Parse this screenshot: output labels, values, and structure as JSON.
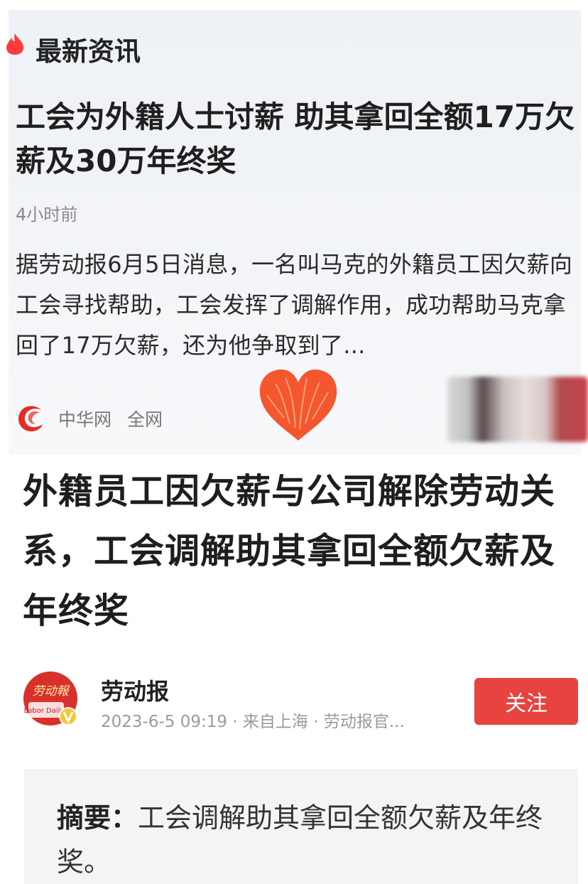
{
  "news_card": {
    "section_title": "最新资讯",
    "headline": "工会为外籍人士讨薪 助其拿回全额17万欠薪及30万年终奖",
    "time_ago": "4小时前",
    "summary": "据劳动报6月5日消息，一名叫马克的外籍员工因欠薪向工会寻找帮助，工会发挥了调解作用，成功帮助马克拿回了17万欠薪，还为他争取到了...",
    "source_name": "中华网",
    "source_scope": "全网"
  },
  "article": {
    "title": "外籍员工因欠薪与公司解除劳动关系，工会调解助其拿回全额欠薪及年终奖",
    "author": "劳动报",
    "meta": "2023-6-5 09:19 · 来自上海 · 劳动报官...",
    "follow_label": "关注",
    "abstract_label": "摘要：",
    "abstract_text": "工会调解助其拿回全额欠薪及年终奖。"
  },
  "icons": [
    "flame-icon",
    "zhonghua-logo-icon",
    "heart-sticker-icon",
    "laodongbao-logo-icon"
  ],
  "colors": {
    "accent_red": "#e7433f",
    "heart": "#f4572d"
  }
}
